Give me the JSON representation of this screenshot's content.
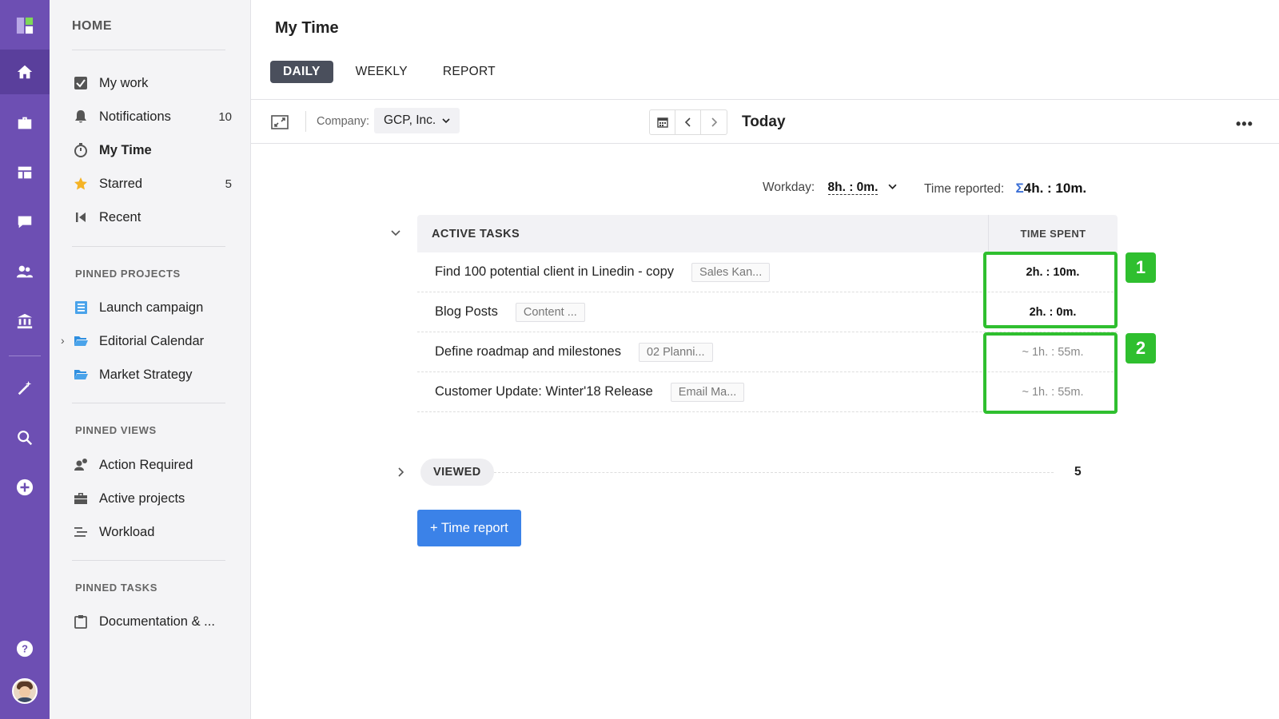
{
  "sidebar": {
    "home_label": "HOME",
    "nav": [
      {
        "label": "My work",
        "count": ""
      },
      {
        "label": "Notifications",
        "count": "10"
      },
      {
        "label": "My Time",
        "count": ""
      },
      {
        "label": "Starred",
        "count": "5"
      },
      {
        "label": "Recent",
        "count": ""
      }
    ],
    "pinned_projects_label": "PINNED PROJECTS",
    "pinned_projects": [
      "Launch campaign",
      "Editorial Calendar",
      "Market Strategy"
    ],
    "pinned_views_label": "PINNED VIEWS",
    "pinned_views": [
      "Action Required",
      "Active projects",
      "Workload"
    ],
    "pinned_tasks_label": "PINNED TASKS",
    "pinned_tasks": [
      "Documentation & ..."
    ]
  },
  "main": {
    "title": "My Time",
    "tabs": [
      "DAILY",
      "WEEKLY",
      "REPORT"
    ],
    "toolbar": {
      "company_label": "Company:",
      "company_value": "GCP, Inc.",
      "date_label": "Today",
      "more": "•••"
    },
    "summary": {
      "workday_label": "Workday:",
      "workday_value": "8h. : 0m.",
      "reported_label": "Time reported:",
      "sigma": "Σ",
      "reported_value": "4h. : 10m."
    },
    "table": {
      "header_tasks": "ACTIVE TASKS",
      "header_time": "TIME SPENT",
      "rows": [
        {
          "name": "Find 100 potential client in Linedin - copy",
          "project": "Sales Kan...",
          "time": "2h. : 10m."
        },
        {
          "name": "Blog Posts",
          "project": "Content ...",
          "time": "2h. : 0m."
        },
        {
          "name": "Define roadmap and milestones",
          "project": "02 Planni...",
          "time": "~ 1h. : 55m."
        },
        {
          "name": "Customer Update: Winter'18 Release",
          "project": "Email Ma...",
          "time": "~ 1h. : 55m."
        }
      ]
    },
    "badges": [
      "1",
      "2"
    ],
    "viewed": {
      "label": "VIEWED",
      "count": "5"
    },
    "add_button": "+ Time report"
  },
  "colors": {
    "rail": "#6d4fb3",
    "highlight": "#2fbf2f",
    "primary_button": "#3b82e8",
    "active_tab": "#4a4f5c"
  }
}
